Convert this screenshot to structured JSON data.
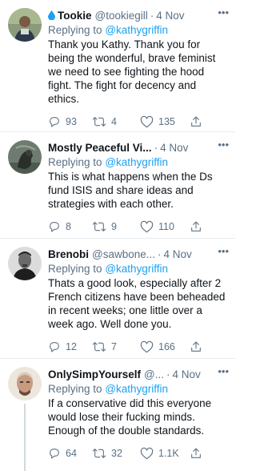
{
  "colors": {
    "accent": "#1da1f2",
    "muted": "#5b7083",
    "text": "#0f1419",
    "divider": "#e6ecf0"
  },
  "reply_prefix": "Replying to",
  "tweets": [
    {
      "name_icon": "water-drop-icon",
      "name": "Tookie",
      "handle": "@tookiegill",
      "dot": "·",
      "time": "4 Nov",
      "more": "•••",
      "reply_to": "@kathygriffin",
      "text": "Thank you Kathy. Thank you for being the wonderful, brave feminist we need to see fighting the hood fight. The fight for decency and ethics.",
      "replies": "93",
      "retweets": "4",
      "likes": "135"
    },
    {
      "name": "Mostly Peaceful Vi...",
      "handle": "",
      "dot": "·",
      "time": "4 Nov",
      "more": "•••",
      "reply_to": "@kathygriffin",
      "text": "This is what happens when the Ds fund ISIS and share ideas and strategies with each other.",
      "replies": "8",
      "retweets": "9",
      "likes": "110"
    },
    {
      "name": "Brenobi",
      "handle": "@sawbone...",
      "dot": "·",
      "time": "4 Nov",
      "more": "•••",
      "reply_to": "@kathygriffin",
      "text": "Thats a good look, especially after 2 French citizens have been beheaded in recent weeks; one little over a week ago. Well done you.",
      "replies": "12",
      "retweets": "7",
      "likes": "166"
    },
    {
      "name": "OnlySimpYourself",
      "handle": "@...",
      "dot": "·",
      "time": "4 Nov",
      "more": "•••",
      "reply_to": "@kathygriffin",
      "text": "If a conservative did this everyone would lose their fucking minds. Enough of the double standards.",
      "replies": "64",
      "retweets": "32",
      "likes": "1.1K"
    }
  ]
}
